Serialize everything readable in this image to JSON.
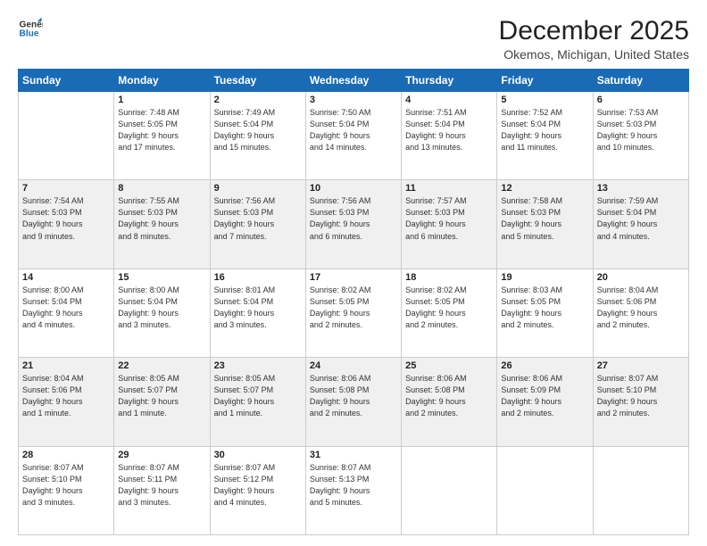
{
  "logo": {
    "line1": "General",
    "line2": "Blue"
  },
  "title": "December 2025",
  "location": "Okemos, Michigan, United States",
  "days_of_week": [
    "Sunday",
    "Monday",
    "Tuesday",
    "Wednesday",
    "Thursday",
    "Friday",
    "Saturday"
  ],
  "weeks": [
    [
      {
        "day": "",
        "info": ""
      },
      {
        "day": "1",
        "info": "Sunrise: 7:48 AM\nSunset: 5:05 PM\nDaylight: 9 hours\nand 17 minutes."
      },
      {
        "day": "2",
        "info": "Sunrise: 7:49 AM\nSunset: 5:04 PM\nDaylight: 9 hours\nand 15 minutes."
      },
      {
        "day": "3",
        "info": "Sunrise: 7:50 AM\nSunset: 5:04 PM\nDaylight: 9 hours\nand 14 minutes."
      },
      {
        "day": "4",
        "info": "Sunrise: 7:51 AM\nSunset: 5:04 PM\nDaylight: 9 hours\nand 13 minutes."
      },
      {
        "day": "5",
        "info": "Sunrise: 7:52 AM\nSunset: 5:04 PM\nDaylight: 9 hours\nand 11 minutes."
      },
      {
        "day": "6",
        "info": "Sunrise: 7:53 AM\nSunset: 5:03 PM\nDaylight: 9 hours\nand 10 minutes."
      }
    ],
    [
      {
        "day": "7",
        "info": "Sunrise: 7:54 AM\nSunset: 5:03 PM\nDaylight: 9 hours\nand 9 minutes."
      },
      {
        "day": "8",
        "info": "Sunrise: 7:55 AM\nSunset: 5:03 PM\nDaylight: 9 hours\nand 8 minutes."
      },
      {
        "day": "9",
        "info": "Sunrise: 7:56 AM\nSunset: 5:03 PM\nDaylight: 9 hours\nand 7 minutes."
      },
      {
        "day": "10",
        "info": "Sunrise: 7:56 AM\nSunset: 5:03 PM\nDaylight: 9 hours\nand 6 minutes."
      },
      {
        "day": "11",
        "info": "Sunrise: 7:57 AM\nSunset: 5:03 PM\nDaylight: 9 hours\nand 6 minutes."
      },
      {
        "day": "12",
        "info": "Sunrise: 7:58 AM\nSunset: 5:03 PM\nDaylight: 9 hours\nand 5 minutes."
      },
      {
        "day": "13",
        "info": "Sunrise: 7:59 AM\nSunset: 5:04 PM\nDaylight: 9 hours\nand 4 minutes."
      }
    ],
    [
      {
        "day": "14",
        "info": "Sunrise: 8:00 AM\nSunset: 5:04 PM\nDaylight: 9 hours\nand 4 minutes."
      },
      {
        "day": "15",
        "info": "Sunrise: 8:00 AM\nSunset: 5:04 PM\nDaylight: 9 hours\nand 3 minutes."
      },
      {
        "day": "16",
        "info": "Sunrise: 8:01 AM\nSunset: 5:04 PM\nDaylight: 9 hours\nand 3 minutes."
      },
      {
        "day": "17",
        "info": "Sunrise: 8:02 AM\nSunset: 5:05 PM\nDaylight: 9 hours\nand 2 minutes."
      },
      {
        "day": "18",
        "info": "Sunrise: 8:02 AM\nSunset: 5:05 PM\nDaylight: 9 hours\nand 2 minutes."
      },
      {
        "day": "19",
        "info": "Sunrise: 8:03 AM\nSunset: 5:05 PM\nDaylight: 9 hours\nand 2 minutes."
      },
      {
        "day": "20",
        "info": "Sunrise: 8:04 AM\nSunset: 5:06 PM\nDaylight: 9 hours\nand 2 minutes."
      }
    ],
    [
      {
        "day": "21",
        "info": "Sunrise: 8:04 AM\nSunset: 5:06 PM\nDaylight: 9 hours\nand 1 minute."
      },
      {
        "day": "22",
        "info": "Sunrise: 8:05 AM\nSunset: 5:07 PM\nDaylight: 9 hours\nand 1 minute."
      },
      {
        "day": "23",
        "info": "Sunrise: 8:05 AM\nSunset: 5:07 PM\nDaylight: 9 hours\nand 1 minute."
      },
      {
        "day": "24",
        "info": "Sunrise: 8:06 AM\nSunset: 5:08 PM\nDaylight: 9 hours\nand 2 minutes."
      },
      {
        "day": "25",
        "info": "Sunrise: 8:06 AM\nSunset: 5:08 PM\nDaylight: 9 hours\nand 2 minutes."
      },
      {
        "day": "26",
        "info": "Sunrise: 8:06 AM\nSunset: 5:09 PM\nDaylight: 9 hours\nand 2 minutes."
      },
      {
        "day": "27",
        "info": "Sunrise: 8:07 AM\nSunset: 5:10 PM\nDaylight: 9 hours\nand 2 minutes."
      }
    ],
    [
      {
        "day": "28",
        "info": "Sunrise: 8:07 AM\nSunset: 5:10 PM\nDaylight: 9 hours\nand 3 minutes."
      },
      {
        "day": "29",
        "info": "Sunrise: 8:07 AM\nSunset: 5:11 PM\nDaylight: 9 hours\nand 3 minutes."
      },
      {
        "day": "30",
        "info": "Sunrise: 8:07 AM\nSunset: 5:12 PM\nDaylight: 9 hours\nand 4 minutes."
      },
      {
        "day": "31",
        "info": "Sunrise: 8:07 AM\nSunset: 5:13 PM\nDaylight: 9 hours\nand 5 minutes."
      },
      {
        "day": "",
        "info": ""
      },
      {
        "day": "",
        "info": ""
      },
      {
        "day": "",
        "info": ""
      }
    ]
  ]
}
